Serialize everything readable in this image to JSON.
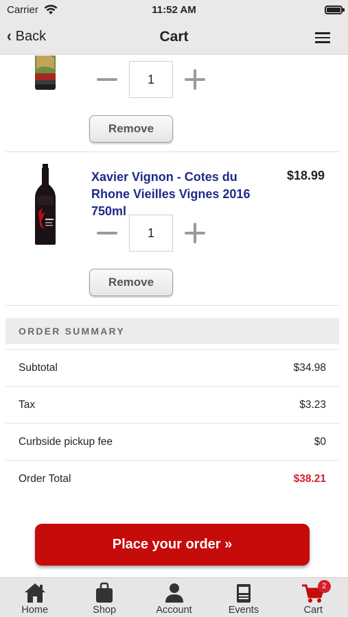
{
  "status_bar": {
    "carrier": "Carrier",
    "time": "11:52 AM"
  },
  "nav": {
    "back_label": "Back",
    "title": "Cart"
  },
  "cart_items": [
    {
      "quantity": "1",
      "remove_label": "Remove"
    },
    {
      "name": "Xavier Vignon - Cotes du Rhone Vieilles Vignes 2016 750ml",
      "price": "$18.99",
      "quantity": "1",
      "remove_label": "Remove"
    }
  ],
  "summary": {
    "header": "ORDER SUMMARY",
    "rows": [
      {
        "label": "Subtotal",
        "value": "$34.98"
      },
      {
        "label": "Tax",
        "value": "$3.23"
      },
      {
        "label": "Curbside pickup fee",
        "value": "$0"
      },
      {
        "label": "Order Total",
        "value": "$38.21"
      }
    ]
  },
  "place_order_label": "Place your order »",
  "tabs": [
    {
      "label": "Home",
      "icon": "home-icon"
    },
    {
      "label": "Shop",
      "icon": "shopping-bag-icon"
    },
    {
      "label": "Account",
      "icon": "person-icon"
    },
    {
      "label": "Events",
      "icon": "calendar-icon"
    },
    {
      "label": "Cart",
      "icon": "cart-icon",
      "badge": "2"
    }
  ],
  "colors": {
    "accent_red": "#c60b0b",
    "total_red": "#d41f2b",
    "title_blue": "#1e2a8a",
    "bar_gray": "#e9e9e9"
  }
}
